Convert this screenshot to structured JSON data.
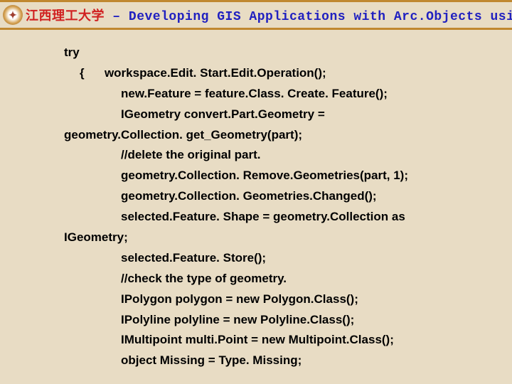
{
  "header": {
    "title_cn": "江西理工大学",
    "title_sep": " – ",
    "title_en": "Developing GIS Applications with Arc.Objects using C#. NE"
  },
  "code": {
    "lines": [
      {
        "indent": "indent-0",
        "text": "try"
      },
      {
        "indent": "indent-1",
        "text": "{      workspace.Edit. Start.Edit.Operation();"
      },
      {
        "indent": "indent-2",
        "text": "new.Feature = feature.Class. Create. Feature();"
      },
      {
        "indent": "indent-2",
        "text": "IGeometry convert.Part.Geometry ="
      },
      {
        "indent": "indent-wrap",
        "text": "geometry.Collection. get_Geometry(part);"
      },
      {
        "indent": "indent-2",
        "text": "//delete the original part."
      },
      {
        "indent": "indent-2",
        "text": "geometry.Collection. Remove.Geometries(part, 1);"
      },
      {
        "indent": "indent-2",
        "text": "geometry.Collection. Geometries.Changed();"
      },
      {
        "indent": "indent-2",
        "text": "selected.Feature. Shape = geometry.Collection as"
      },
      {
        "indent": "indent-wrap",
        "text": "IGeometry;"
      },
      {
        "indent": "indent-2",
        "text": "selected.Feature. Store();"
      },
      {
        "indent": "indent-2",
        "text": "//check the type of geometry."
      },
      {
        "indent": "indent-2",
        "text": "IPolygon polygon = new Polygon.Class();"
      },
      {
        "indent": "indent-2",
        "text": "IPolyline polyline = new Polyline.Class();"
      },
      {
        "indent": "indent-2",
        "text": "IMultipoint multi.Point = new Multipoint.Class();"
      },
      {
        "indent": "indent-2",
        "text": "object Missing = Type. Missing;"
      }
    ]
  }
}
